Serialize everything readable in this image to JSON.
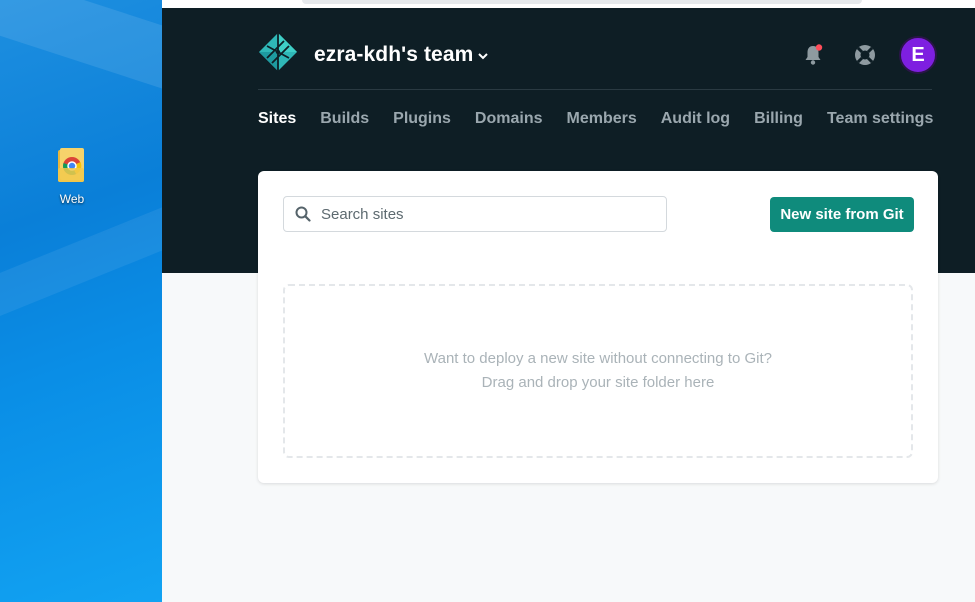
{
  "desktop": {
    "icon_label": "Web"
  },
  "header": {
    "team_name": "ezra-kdh's team",
    "avatar_letter": "E",
    "avatar_color": "#7e1fe0",
    "notification_dot_color": "#ff4d5a",
    "background_color": "#0e1e25"
  },
  "tabs": [
    {
      "label": "Sites",
      "active": true
    },
    {
      "label": "Builds",
      "active": false
    },
    {
      "label": "Plugins",
      "active": false
    },
    {
      "label": "Domains",
      "active": false
    },
    {
      "label": "Members",
      "active": false
    },
    {
      "label": "Audit log",
      "active": false
    },
    {
      "label": "Billing",
      "active": false
    },
    {
      "label": "Team settings",
      "active": false
    }
  ],
  "sites": {
    "search_placeholder": "Search sites",
    "search_value": "",
    "new_site_label": "New site from Git",
    "new_site_color": "#0f8b7c",
    "dropzone_line1": "Want to deploy a new site without connecting to Git?",
    "dropzone_line2": "Drag and drop your site folder here"
  },
  "icons": {
    "logo": "netlify-logo-icon",
    "notifications": "bell-icon",
    "support": "lifebuoy-icon",
    "search": "search-icon",
    "team_menu": "chevron-down-icon",
    "desktop_folder": "folder-icon"
  }
}
